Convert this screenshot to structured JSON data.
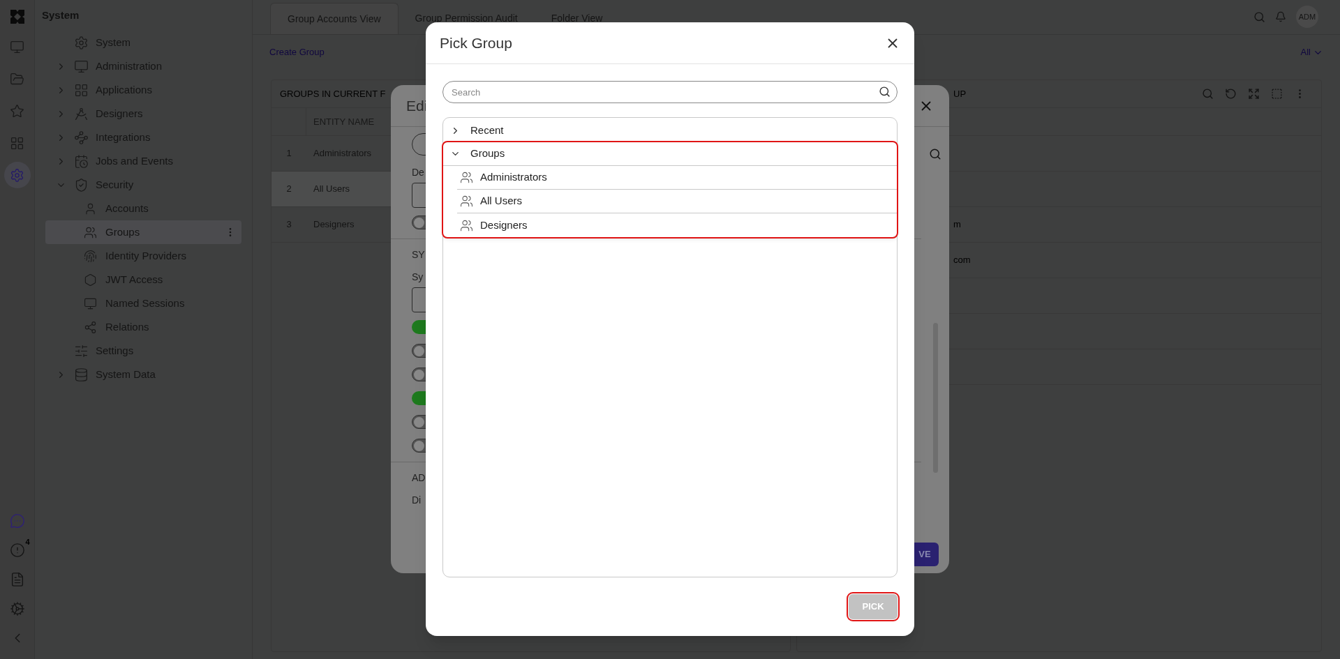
{
  "app": {
    "title": "System"
  },
  "rail": {
    "items": [
      {
        "selected": false
      },
      {
        "selected": false
      },
      {
        "selected": false
      },
      {
        "selected": false
      },
      {
        "selected": true
      }
    ],
    "alert_badge": "4"
  },
  "tree": [
    {
      "label": "System"
    },
    {
      "label": "Administration",
      "expanded": false
    },
    {
      "label": "Applications",
      "expanded": false
    },
    {
      "label": "Designers",
      "expanded": false
    },
    {
      "label": "Integrations",
      "expanded": false
    },
    {
      "label": "Jobs and Events",
      "expanded": false
    },
    {
      "label": "Security",
      "expanded": true,
      "children": [
        {
          "label": "Accounts",
          "selected": false
        },
        {
          "label": "Groups",
          "selected": true
        },
        {
          "label": "Identity Providers",
          "selected": false
        },
        {
          "label": "JWT Access",
          "selected": false
        },
        {
          "label": "Named Sessions",
          "selected": false
        },
        {
          "label": "Relations",
          "selected": false
        }
      ]
    },
    {
      "label": "Settings"
    },
    {
      "label": "System Data",
      "expanded": false
    }
  ],
  "tabs": [
    {
      "label": "Group Accounts View",
      "selected": true
    },
    {
      "label": "Group Permission Audit",
      "selected": false
    },
    {
      "label": "Folder View",
      "selected": false
    }
  ],
  "avatar": "ADM",
  "create_link": "Create Group",
  "filter": "All",
  "left_card": {
    "title": "GROUPS IN CURRENT F",
    "columns": [
      "ENTITY NAME"
    ],
    "rows": [
      {
        "number": "1",
        "name": "Administrators",
        "hovered": false
      },
      {
        "number": "2",
        "name": "All Users",
        "hovered": true
      },
      {
        "number": "3",
        "name": "Designers",
        "hovered": false
      }
    ]
  },
  "right_card": {
    "title": "UP",
    "rows": [
      {},
      {},
      {
        "column_1": "m"
      },
      {
        "column_1": "com"
      },
      {},
      {},
      {}
    ]
  },
  "edit_dialog": {
    "title": "Edi",
    "items": [
      {
        "kind": "search"
      },
      {
        "kind": "label",
        "text": "De"
      },
      {
        "kind": "input"
      },
      {
        "kind": "toggle",
        "on": false
      },
      {
        "kind": "divider"
      },
      {
        "kind": "heading",
        "text": "SY"
      },
      {
        "kind": "label",
        "text": "Sy"
      },
      {
        "kind": "input"
      },
      {
        "kind": "toggle",
        "on": true
      },
      {
        "kind": "toggle",
        "on": false
      },
      {
        "kind": "toggle",
        "on": false
      },
      {
        "kind": "toggle",
        "on": true
      },
      {
        "kind": "toggle",
        "on": false
      },
      {
        "kind": "toggle",
        "on": false
      },
      {
        "kind": "divider"
      },
      {
        "kind": "heading",
        "text": "AD"
      },
      {
        "kind": "label",
        "text": "Di"
      }
    ],
    "save_button": "VE"
  },
  "pick_dialog": {
    "title": "Pick Group",
    "search_placeholder": "Search",
    "tree": [
      {
        "label": "Recent",
        "expanded": false
      },
      {
        "label": "Groups",
        "expanded": true,
        "highlighted": true,
        "children": [
          {
            "label": "Administrators"
          },
          {
            "label": "All Users"
          },
          {
            "label": "Designers"
          }
        ]
      }
    ],
    "pick_button": {
      "label": "PICK",
      "disabled": true,
      "highlighted": true
    }
  }
}
